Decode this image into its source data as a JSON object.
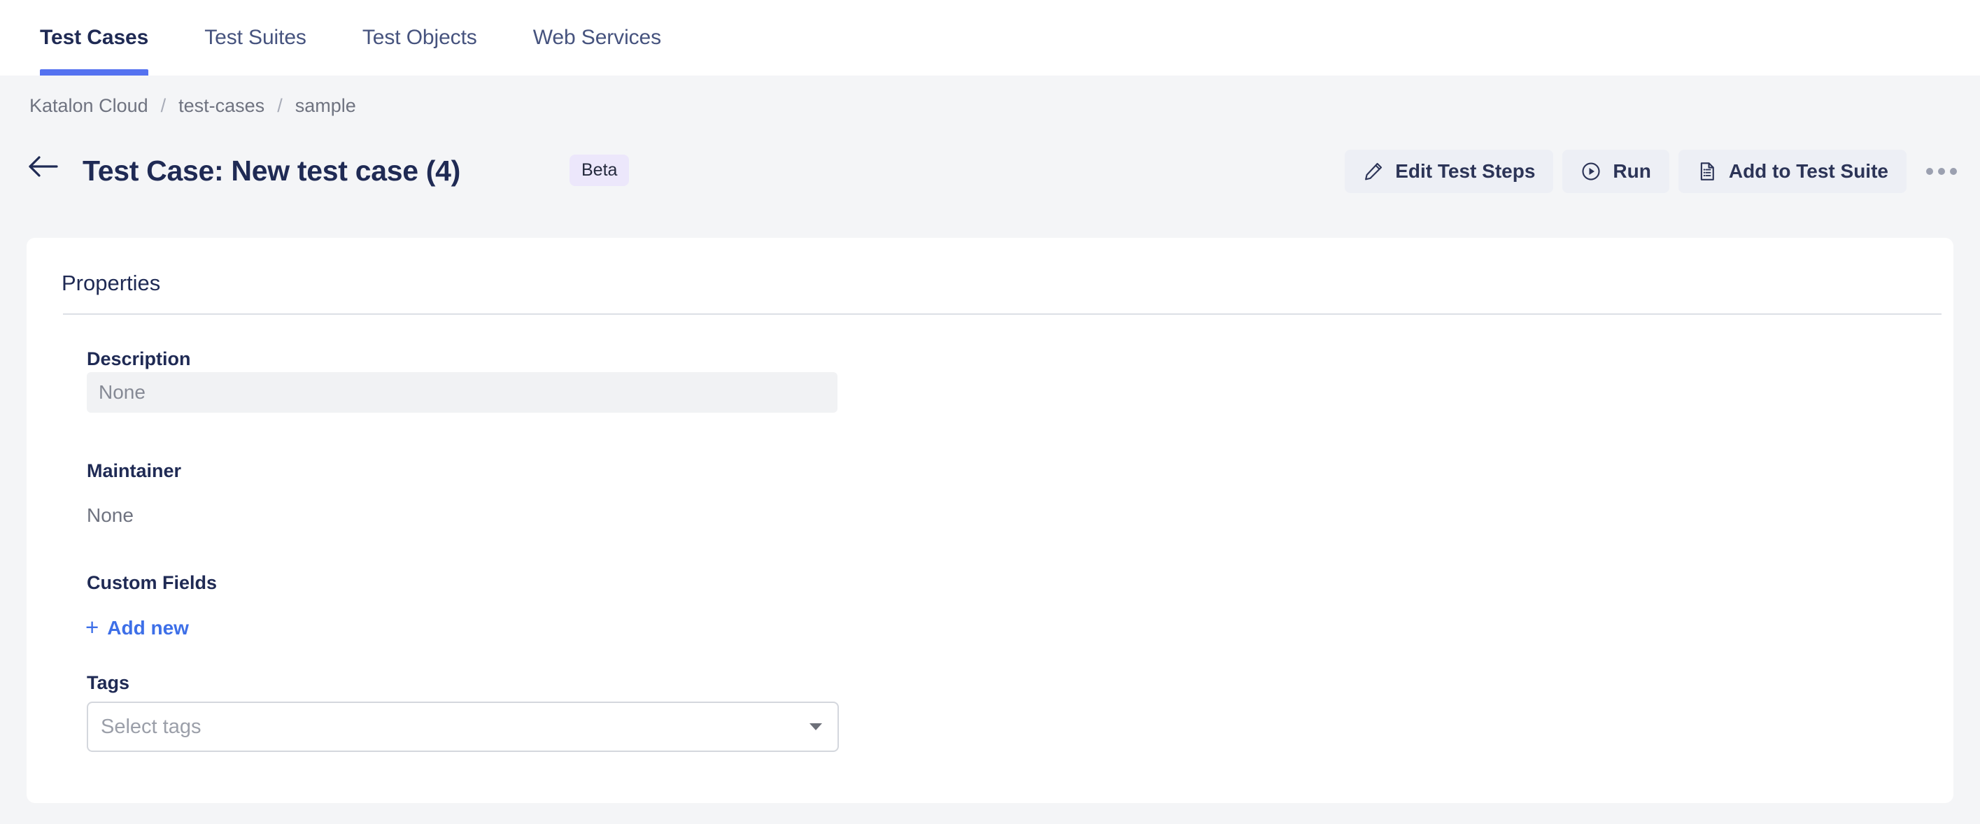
{
  "tabs": [
    {
      "label": "Test Cases",
      "active": true
    },
    {
      "label": "Test Suites",
      "active": false
    },
    {
      "label": "Test Objects",
      "active": false
    },
    {
      "label": "Web Services",
      "active": false
    }
  ],
  "breadcrumb": {
    "items": [
      "Katalon Cloud",
      "test-cases",
      "sample"
    ],
    "separator": "/"
  },
  "header": {
    "title": "Test Case: New test case (4)",
    "badge": "Beta",
    "back_icon": "arrow-left-icon",
    "actions": {
      "edit_test_steps": "Edit Test Steps",
      "run": "Run",
      "add_to_test_suite": "Add to Test Suite",
      "more": "more-options-icon"
    }
  },
  "panel": {
    "title": "Properties",
    "fields": {
      "description_label": "Description",
      "description_value": "None",
      "maintainer_label": "Maintainer",
      "maintainer_value": "None",
      "custom_fields_label": "Custom Fields",
      "add_new_label": "Add new",
      "add_new_icon": "plus-icon",
      "tags_label": "Tags",
      "tags_placeholder": "Select tags"
    }
  },
  "colors": {
    "accent_blue": "#5472f0",
    "link_blue": "#3d6fe8",
    "title_navy": "#1f2a54",
    "badge_bg": "#ece7fb",
    "button_bg": "#edeff5",
    "page_bg": "#f4f5f7",
    "panel_bg": "#ffffff"
  }
}
